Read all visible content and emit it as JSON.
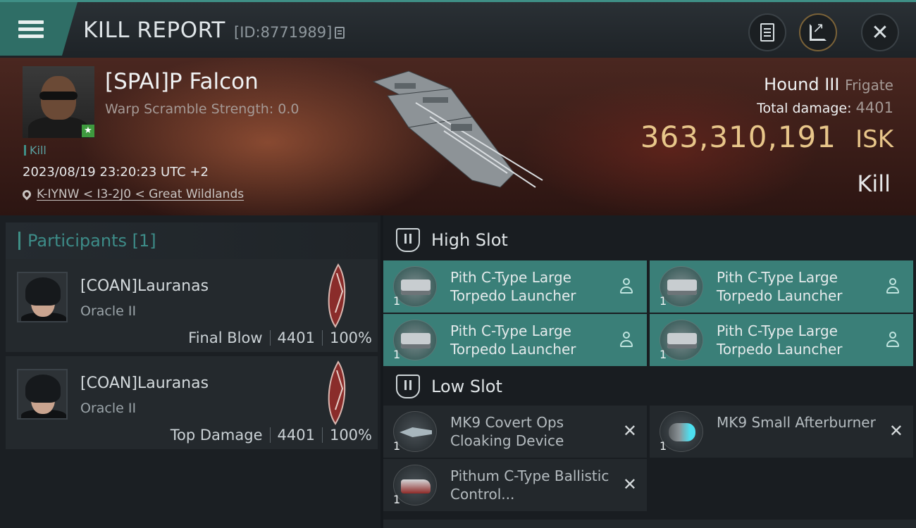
{
  "header": {
    "title": "KILL REPORT",
    "kill_id": "[ID:8771989]"
  },
  "victim": {
    "pilot_name": "[SPAI]P Falcon",
    "warp_scramble": "Warp Scramble Strength: 0.0",
    "tag": "Kill",
    "timestamp": "2023/08/19 23:20:23 UTC +2",
    "location": "K-IYNW < I3-2J0 < Great Wildlands",
    "ship_name": "Hound III",
    "ship_class": "Frigate",
    "total_damage_label": "Total damage:",
    "total_damage": "4401",
    "isk_value": "363,310,191",
    "isk_unit": "ISK",
    "result": "Kill"
  },
  "participants": {
    "header": "Participants [1]",
    "list": [
      {
        "name": "[COAN]Lauranas",
        "ship": "Oracle II",
        "role": "Final Blow",
        "damage": "4401",
        "percent": "100%"
      },
      {
        "name": "[COAN]Lauranas",
        "ship": "Oracle II",
        "role": "Top Damage",
        "damage": "4401",
        "percent": "100%"
      }
    ]
  },
  "fitting": {
    "high_slot": {
      "label": "High Slot",
      "modules": [
        {
          "name": "Pith C-Type Large Torpedo Launcher",
          "qty": "1",
          "icon": "torpedo-launcher-icon"
        },
        {
          "name": "Pith C-Type Large Torpedo Launcher",
          "qty": "1",
          "icon": "torpedo-launcher-icon"
        },
        {
          "name": "Pith C-Type Large Torpedo Launcher",
          "qty": "1",
          "icon": "torpedo-launcher-icon"
        },
        {
          "name": "Pith C-Type Large Torpedo Launcher",
          "qty": "1",
          "icon": "torpedo-launcher-icon"
        }
      ]
    },
    "low_slot": {
      "label": "Low Slot",
      "modules": [
        {
          "name": "MK9 Covert Ops Cloaking Device",
          "qty": "1",
          "icon": "cloaking-device-icon"
        },
        {
          "name": "MK9 Small Afterburner",
          "qty": "1",
          "icon": "afterburner-icon"
        },
        {
          "name": "Pithum C-Type Ballistic Control...",
          "qty": "1",
          "icon": "ballistic-control-icon"
        }
      ]
    }
  },
  "colors": {
    "accent": "#3f8f86",
    "isk": "#e8c68a",
    "high_slot_bg": "#3a7f78"
  }
}
